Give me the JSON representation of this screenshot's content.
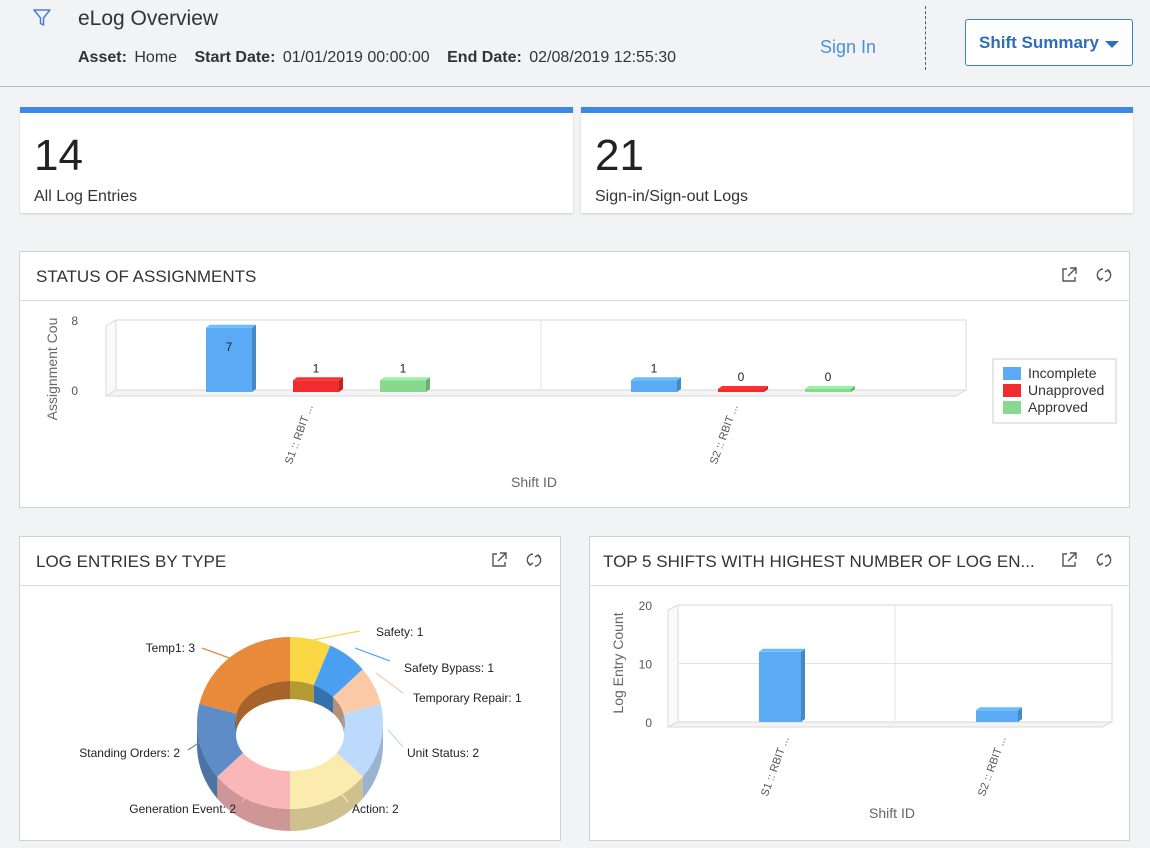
{
  "header": {
    "title": "eLog Overview",
    "asset_label": "Asset:",
    "asset_value": "Home",
    "start_label": "Start Date:",
    "start_value": "01/01/2019 00:00:00",
    "end_label": "End Date:",
    "end_value": "02/08/2019 12:55:30",
    "sign_in": "Sign In",
    "shift_summary": "Shift Summary"
  },
  "kpis": [
    {
      "value": "14",
      "label": "All Log Entries"
    },
    {
      "value": "21",
      "label": "Sign-in/Sign-out Logs"
    }
  ],
  "panels": {
    "status": {
      "title": "STATUS OF ASSIGNMENTS"
    },
    "types": {
      "title": "LOG ENTRIES BY TYPE"
    },
    "top5": {
      "title": "TOP 5 SHIFTS WITH HIGHEST NUMBER OF LOG EN..."
    }
  },
  "chart_data": [
    {
      "type": "bar",
      "title": "STATUS OF ASSIGNMENTS",
      "categories": [
        "S1 :: RBIT ...",
        "S2 :: RBIT ..."
      ],
      "series": [
        {
          "name": "Incomplete",
          "values": [
            7,
            1
          ],
          "color": "#5aaaf5"
        },
        {
          "name": "Unapproved",
          "values": [
            1,
            0
          ],
          "color": "#f02c2c"
        },
        {
          "name": "Approved",
          "values": [
            1,
            0
          ],
          "color": "#88d88f"
        }
      ],
      "xlabel": "Shift ID",
      "ylabel": "Assignment Cou",
      "yticks": [
        0,
        8
      ],
      "ylim": [
        0,
        8
      ],
      "legend": "right"
    },
    {
      "type": "pie",
      "title": "LOG ENTRIES BY TYPE",
      "slices": [
        {
          "label": "Safety",
          "value": 1,
          "color": "#f9d745"
        },
        {
          "label": "Safety Bypass",
          "value": 1,
          "color": "#4a9ff0"
        },
        {
          "label": "Temporary Repair",
          "value": 1,
          "color": "#fcc9a6"
        },
        {
          "label": "Unit Status",
          "value": 2,
          "color": "#bcdafb"
        },
        {
          "label": "Action",
          "value": 2,
          "color": "#fbebad"
        },
        {
          "label": "Generation Event",
          "value": 2,
          "color": "#fbb7b7"
        },
        {
          "label": "Standing Orders",
          "value": 2,
          "color": "#5e8cc6"
        },
        {
          "label": "Temp1",
          "value": 3,
          "color": "#e88a3a"
        }
      ]
    },
    {
      "type": "bar",
      "title": "TOP 5 SHIFTS WITH HIGHEST NUMBER OF LOG EN...",
      "categories": [
        "S1 :: RBIT ...",
        "S2 :: RBIT ..."
      ],
      "values": [
        12,
        2
      ],
      "color": "#5aaaf5",
      "xlabel": "Shift ID",
      "ylabel": "Log Entry Count",
      "yticks": [
        0,
        10,
        20
      ],
      "ylim": [
        0,
        20
      ]
    }
  ]
}
